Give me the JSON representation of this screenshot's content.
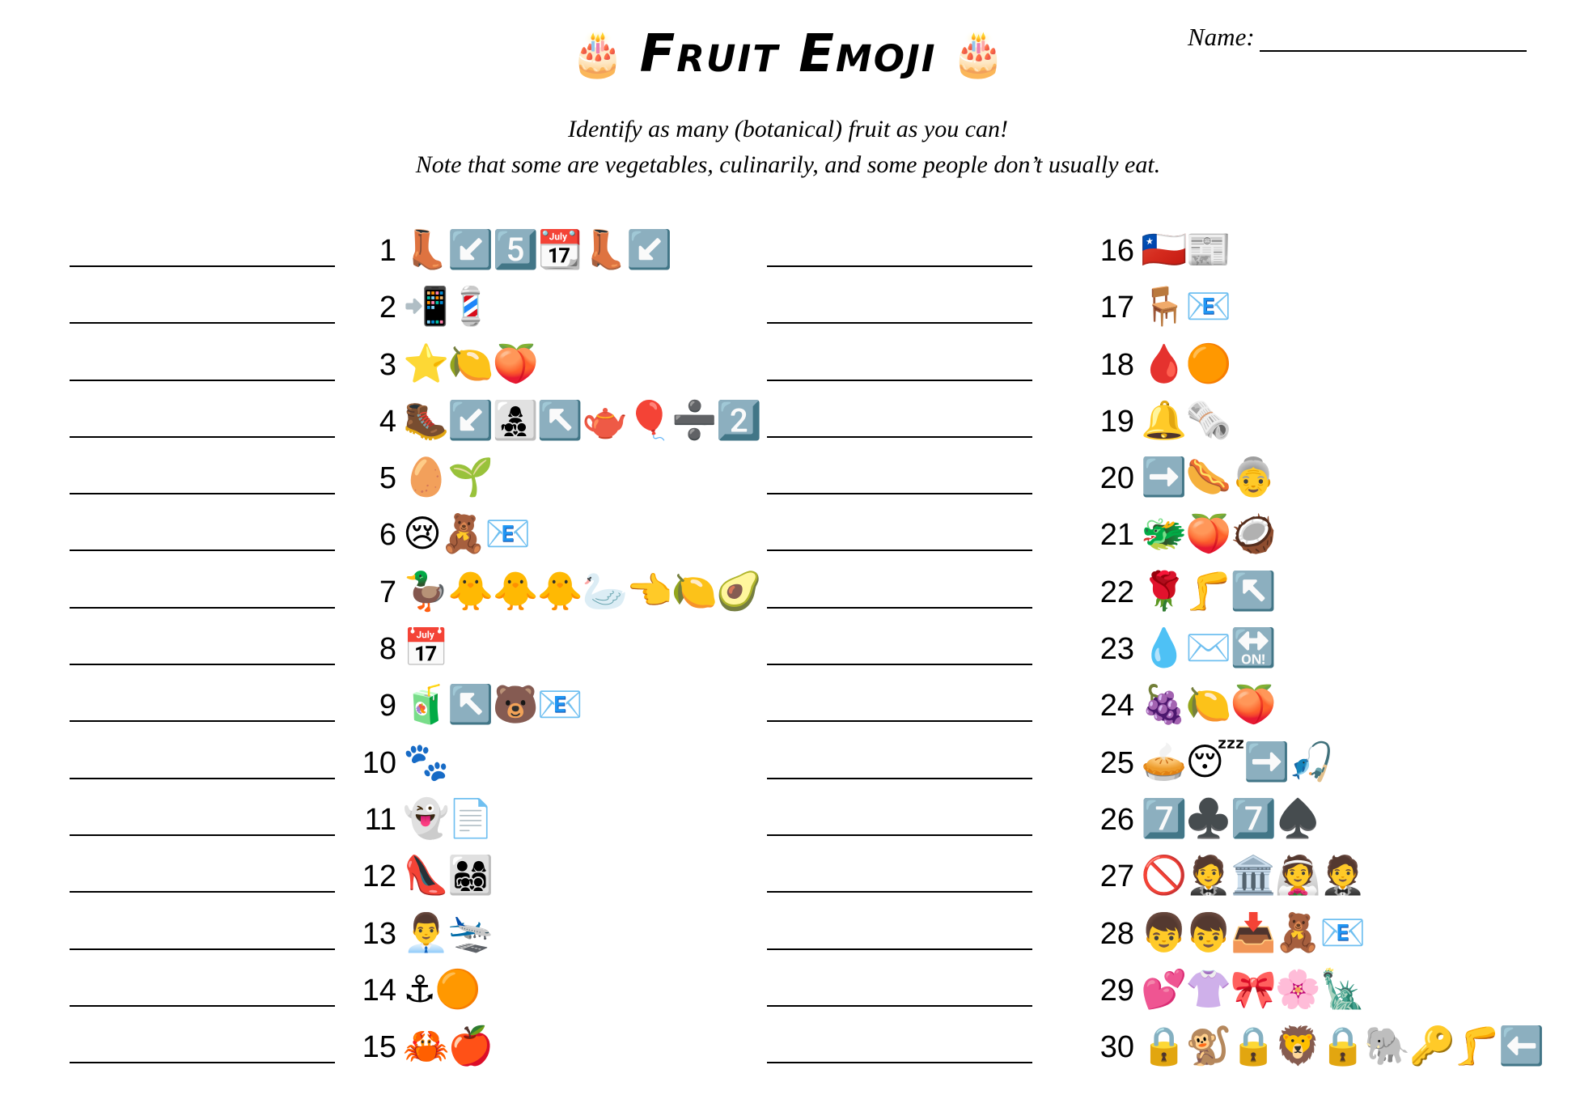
{
  "header": {
    "title": "Fruit Emoji",
    "cake_icon": "🎂",
    "name_label": "Name:",
    "instruction_1": "Identify as many (botanical) fruit as you can!",
    "instruction_2": "Note that some are vegetables, culinarily, and some people don’t usually eat."
  },
  "left_items": [
    {
      "number": "1",
      "clue": "👢↙️5️⃣📆👢↙️"
    },
    {
      "number": "2",
      "clue": "📲💈"
    },
    {
      "number": "3",
      "clue": "⭐🍋🍑"
    },
    {
      "number": "4",
      "clue": "🥾↙️👩‍👧‍👦↖️🫖🎈➗2️⃣"
    },
    {
      "number": "5",
      "clue": "🥚🌱"
    },
    {
      "number": "6",
      "clue": "😢🧸📧"
    },
    {
      "number": "7",
      "clue": "🦆🐥🐥🐥🦢👈🍋🥑"
    },
    {
      "number": "8",
      "clue": "📅"
    },
    {
      "number": "9",
      "clue": "🧃↖️🐻📧"
    },
    {
      "number": "10",
      "clue": "🐾"
    },
    {
      "number": "11",
      "clue": "👻📄"
    },
    {
      "number": "12",
      "clue": "👠👨‍👩‍👧‍👦"
    },
    {
      "number": "13",
      "clue": "👨‍💼🛬"
    },
    {
      "number": "14",
      "clue": "⚓🟠"
    },
    {
      "number": "15",
      "clue": "🦀🍎"
    }
  ],
  "right_items": [
    {
      "number": "16",
      "clue": "🇨🇱📰"
    },
    {
      "number": "17",
      "clue": "🪑📧"
    },
    {
      "number": "18",
      "clue": "🩸🟠"
    },
    {
      "number": "19",
      "clue": "🔔🗞️"
    },
    {
      "number": "20",
      "clue": "➡️🌭👵"
    },
    {
      "number": "21",
      "clue": "🐲🍑🥥"
    },
    {
      "number": "22",
      "clue": "🌹🦵↖️"
    },
    {
      "number": "23",
      "clue": "💧✉️🔛"
    },
    {
      "number": "24",
      "clue": "🍇🍋🍑"
    },
    {
      "number": "25",
      "clue": "🥧😴➡️🎣"
    },
    {
      "number": "26",
      "clue": "7️⃣♣️7️⃣♠️"
    },
    {
      "number": "27",
      "clue": "🚫🤵🏛️👰🤵"
    },
    {
      "number": "28",
      "clue": "👦👦📥🧸📧"
    },
    {
      "number": "29",
      "clue": "💕👚🎀🌸🗽"
    },
    {
      "number": "30",
      "clue": "🔒🐒🔒🦁🔒🐘🔑🦵⬅️"
    }
  ]
}
